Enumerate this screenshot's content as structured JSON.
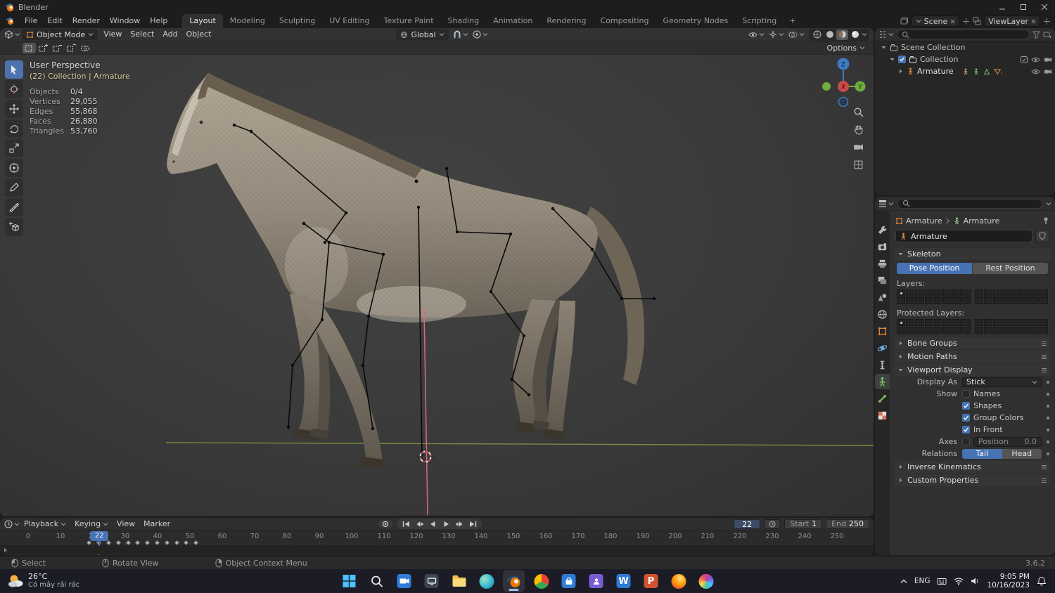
{
  "colors": {
    "accent": "#4772b3",
    "axis_x": "#cc4a4a",
    "axis_y": "#6fae3e",
    "axis_z": "#3e7cc1",
    "collection_orange": "#e0883c",
    "data_green": "#7cc565"
  },
  "window": {
    "title": "Blender"
  },
  "menubar": {
    "menus": [
      "File",
      "Edit",
      "Render",
      "Window",
      "Help"
    ],
    "workspaces": [
      "Layout",
      "Modeling",
      "Sculpting",
      "UV Editing",
      "Texture Paint",
      "Shading",
      "Animation",
      "Rendering",
      "Compositing",
      "Geometry Nodes",
      "Scripting"
    ],
    "active_workspace": "Layout",
    "add_workspace": "+",
    "scene_label": "Scene",
    "viewlayer_label": "ViewLayer"
  },
  "viewport_header": {
    "mode": "Object Mode",
    "menus": [
      "View",
      "Select",
      "Add",
      "Object"
    ],
    "orientation": "Global",
    "select_modes": [
      "new",
      "extend",
      "subtract",
      "invert",
      "intersect"
    ],
    "options": "Options"
  },
  "viewport": {
    "tools": [
      "select-box",
      "cursor",
      "move",
      "rotate",
      "scale",
      "transform",
      "annotate",
      "measure",
      "add-cube"
    ],
    "active_tool": "select-box",
    "overlay": {
      "perspective": "User Perspective",
      "context": "(22) Collection | Armature",
      "stats": [
        {
          "label": "Objects",
          "value": "0/4"
        },
        {
          "label": "Vertices",
          "value": "29,055"
        },
        {
          "label": "Edges",
          "value": "55,868"
        },
        {
          "label": "Faces",
          "value": "26,880"
        },
        {
          "label": "Triangles",
          "value": "53,760"
        }
      ]
    },
    "gizmo_axes": {
      "x": "X",
      "y": "Y",
      "z": "Z"
    }
  },
  "outliner": {
    "rows": [
      {
        "label": "Scene Collection"
      },
      {
        "label": "Collection"
      },
      {
        "label": "Armature"
      }
    ]
  },
  "properties": {
    "tabs": [
      "tool",
      "render",
      "output",
      "view-layer",
      "scene",
      "world",
      "object",
      "physics",
      "constraints",
      "object-data",
      "bone",
      "texture"
    ],
    "active_tab": "object-data",
    "breadcrumb": {
      "object": "Armature",
      "data": "Armature"
    },
    "name_value": "Armature",
    "skeleton": {
      "title": "Skeleton",
      "pose": "Pose Position",
      "rest": "Rest Position",
      "layers_label": "Layers:",
      "protected_label": "Protected Layers:"
    },
    "collapsed_top": [
      "Bone Groups",
      "Motion Paths"
    ],
    "viewport_display": {
      "title": "Viewport Display",
      "display_as_label": "Display As",
      "display_as_value": "Stick",
      "show_label": "Show",
      "options": [
        {
          "label": "Names",
          "checked": false
        },
        {
          "label": "Shapes",
          "checked": true
        },
        {
          "label": "Group Colors",
          "checked": true
        },
        {
          "label": "In Front",
          "checked": true
        }
      ],
      "axes_label": "Axes",
      "position_label": "Position",
      "position_value": "0.0",
      "relations_label": "Relations",
      "tail": "Tail",
      "head": "Head"
    },
    "collapsed_bottom": [
      "Inverse Kinematics",
      "Custom Properties"
    ]
  },
  "timeline": {
    "menus": [
      {
        "label": "Playback",
        "caret": true
      },
      {
        "label": "Keying",
        "caret": true
      },
      {
        "label": "View",
        "caret": false
      },
      {
        "label": "Marker",
        "caret": false
      }
    ],
    "transport": [
      "jump-first",
      "prev-keyframe",
      "play-reverse",
      "play",
      "next-keyframe",
      "jump-last"
    ],
    "current_frame": "22",
    "start_label": "Start",
    "start_value": "1",
    "end_label": "End",
    "end_value": "250",
    "ticks": [
      0,
      10,
      20,
      30,
      40,
      50,
      60,
      70,
      80,
      90,
      100,
      110,
      120,
      130,
      140,
      150,
      160,
      170,
      180,
      190,
      200,
      210,
      220,
      230,
      240,
      250
    ],
    "keyframes": [
      19,
      22,
      25,
      28,
      31,
      34,
      37,
      40,
      43,
      46,
      49,
      52
    ]
  },
  "statusbar": {
    "hints": [
      {
        "mouse": "left",
        "label": "Select"
      },
      {
        "mouse": "middle",
        "label": "Rotate View"
      },
      {
        "mouse": "right",
        "label": "Object Context Menu"
      }
    ],
    "version": "3.6.2"
  },
  "taskbar": {
    "weather_temp": "26°C",
    "weather_desc": "Có mây rải rác",
    "apps": [
      "start",
      "search",
      "camera",
      "monitor",
      "explorer",
      "edge",
      "blender",
      "chrome",
      "store",
      "purple-app",
      "word",
      "powerpoint",
      "firefox",
      "photos"
    ],
    "active_app": "blender",
    "language": "ENG",
    "time": "9:05 PM",
    "date": "10/16/2023"
  }
}
